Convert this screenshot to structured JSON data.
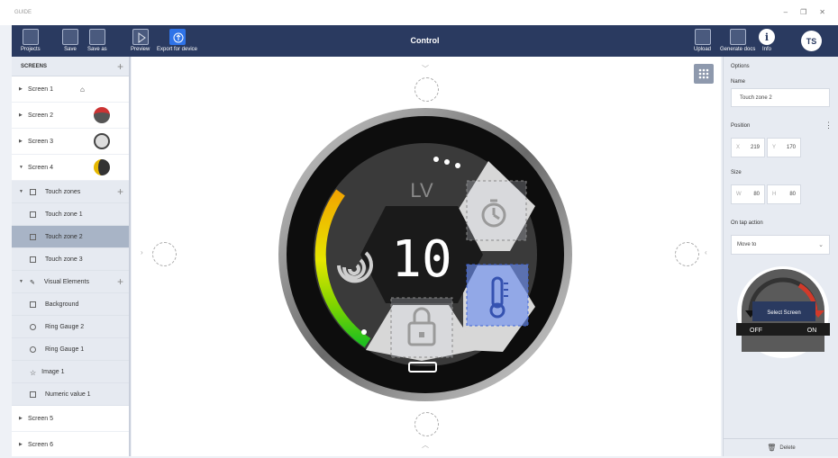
{
  "app": {
    "title": "GUIDE",
    "window_controls": [
      "–",
      "❐",
      "✕"
    ]
  },
  "toolbar": {
    "projects": "Projects",
    "save": "Save",
    "save_as": "Save as",
    "preview": "Preview",
    "export": "Export for device",
    "title": "Control",
    "upload": "Upload",
    "generate_docs": "Generate docs",
    "info": "Info",
    "avatar": "TS"
  },
  "sidebar": {
    "header": "SCREENS",
    "screens": [
      "Screen 1",
      "Screen 2",
      "Screen 3",
      "Screen 4",
      "Screen 5",
      "Screen 6"
    ],
    "touch_zones_label": "Touch zones",
    "touch_zones": [
      "Touch zone 1",
      "Touch zone 2",
      "Touch zone 3"
    ],
    "visual_elements_label": "Visual Elements",
    "visual_elements": [
      "Background",
      "Ring Gauge 2",
      "Ring Gauge 1",
      "Image 1",
      "Numeric value 1"
    ]
  },
  "canvas": {
    "value": "10",
    "unit": "LV"
  },
  "options": {
    "title": "Options",
    "name_label": "Name",
    "name_value": "Touch zone 2",
    "position_label": "Position",
    "x_label": "X",
    "x_value": "219",
    "y_label": "Y",
    "y_value": "170",
    "size_label": "Size",
    "w_label": "W",
    "w_value": "80",
    "h_label": "H",
    "h_value": "80",
    "action_label": "On tap action",
    "action_value": "Move to",
    "preview_button": "Select Screen",
    "preview_off": "OFF",
    "preview_on": "ON",
    "delete": "Delete"
  },
  "colors": {
    "toolbar": "#2a3a60",
    "selected_zone": "#6d8ff0",
    "accent": "#2f73e8"
  }
}
